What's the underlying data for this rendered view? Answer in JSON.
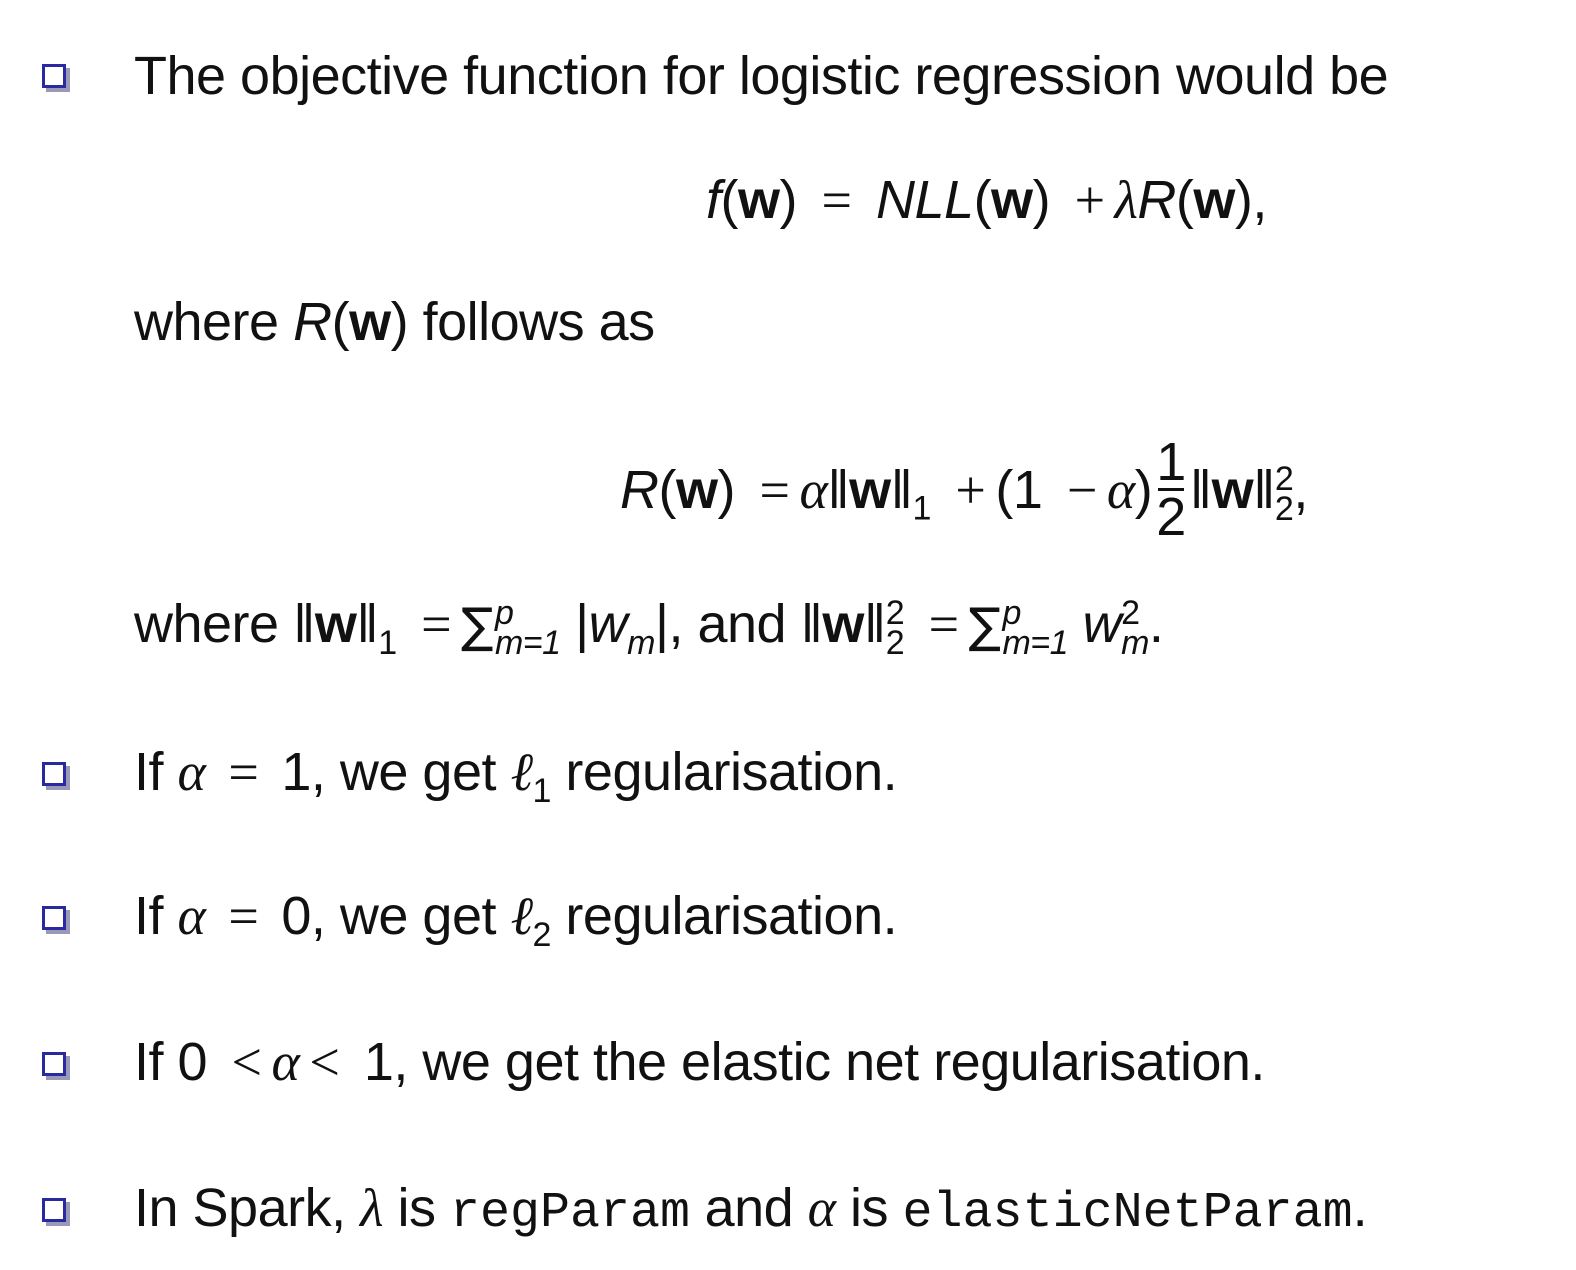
{
  "bullets": [
    {
      "text": "The objective function for logistic regression would be"
    },
    {
      "prefix": "If ",
      "alpha": "α",
      "eq": " = ",
      "val": "1",
      "mid": ", we get ",
      "ell": "ℓ",
      "sub": "1",
      "suffix": " regularisation."
    },
    {
      "prefix": "If ",
      "alpha": "α",
      "eq": " = ",
      "val": "0",
      "mid": ", we get ",
      "ell": "ℓ",
      "sub": "2",
      "suffix": " regularisation."
    },
    {
      "prefix": "If 0 ",
      "lt1": "<",
      "alpha": "α",
      "lt2": "<",
      "suffix": " 1, we get the elastic net regularisation."
    },
    {
      "prefix": "In Spark, ",
      "lambda": "λ",
      "is1": " is ",
      "param1": "regParam",
      "and": " and ",
      "alpha": "α",
      "is2": " is ",
      "param2": "elasticNetParam",
      "end": "."
    }
  ],
  "eq1": {
    "f": "f",
    "w": "w",
    "eq": "=",
    "nll": "NLL",
    "plus": "+",
    "lambda": "λ",
    "R": "R",
    "end": ","
  },
  "where1": {
    "prefix": "where ",
    "R": "R",
    "w": "w",
    "suffix": " follows as"
  },
  "eq2": {
    "R": "R",
    "w": "w",
    "eq": "=",
    "alpha": "α",
    "sub1": "1",
    "plus": "+",
    "one": "(1",
    "minus": "−",
    "close": ")",
    "num": "1",
    "den": "2",
    "sup": "2",
    "sub2": "2",
    "end": ","
  },
  "where2": {
    "prefix": "where ",
    "w": "w",
    "sub1": "1",
    "eq": "=",
    "sum": "∑",
    "top": "p",
    "bot": "m=1",
    "wm": "w",
    "m": "m",
    "and": ", and ",
    "sup": "2",
    "sub2": "2",
    "end": "."
  }
}
